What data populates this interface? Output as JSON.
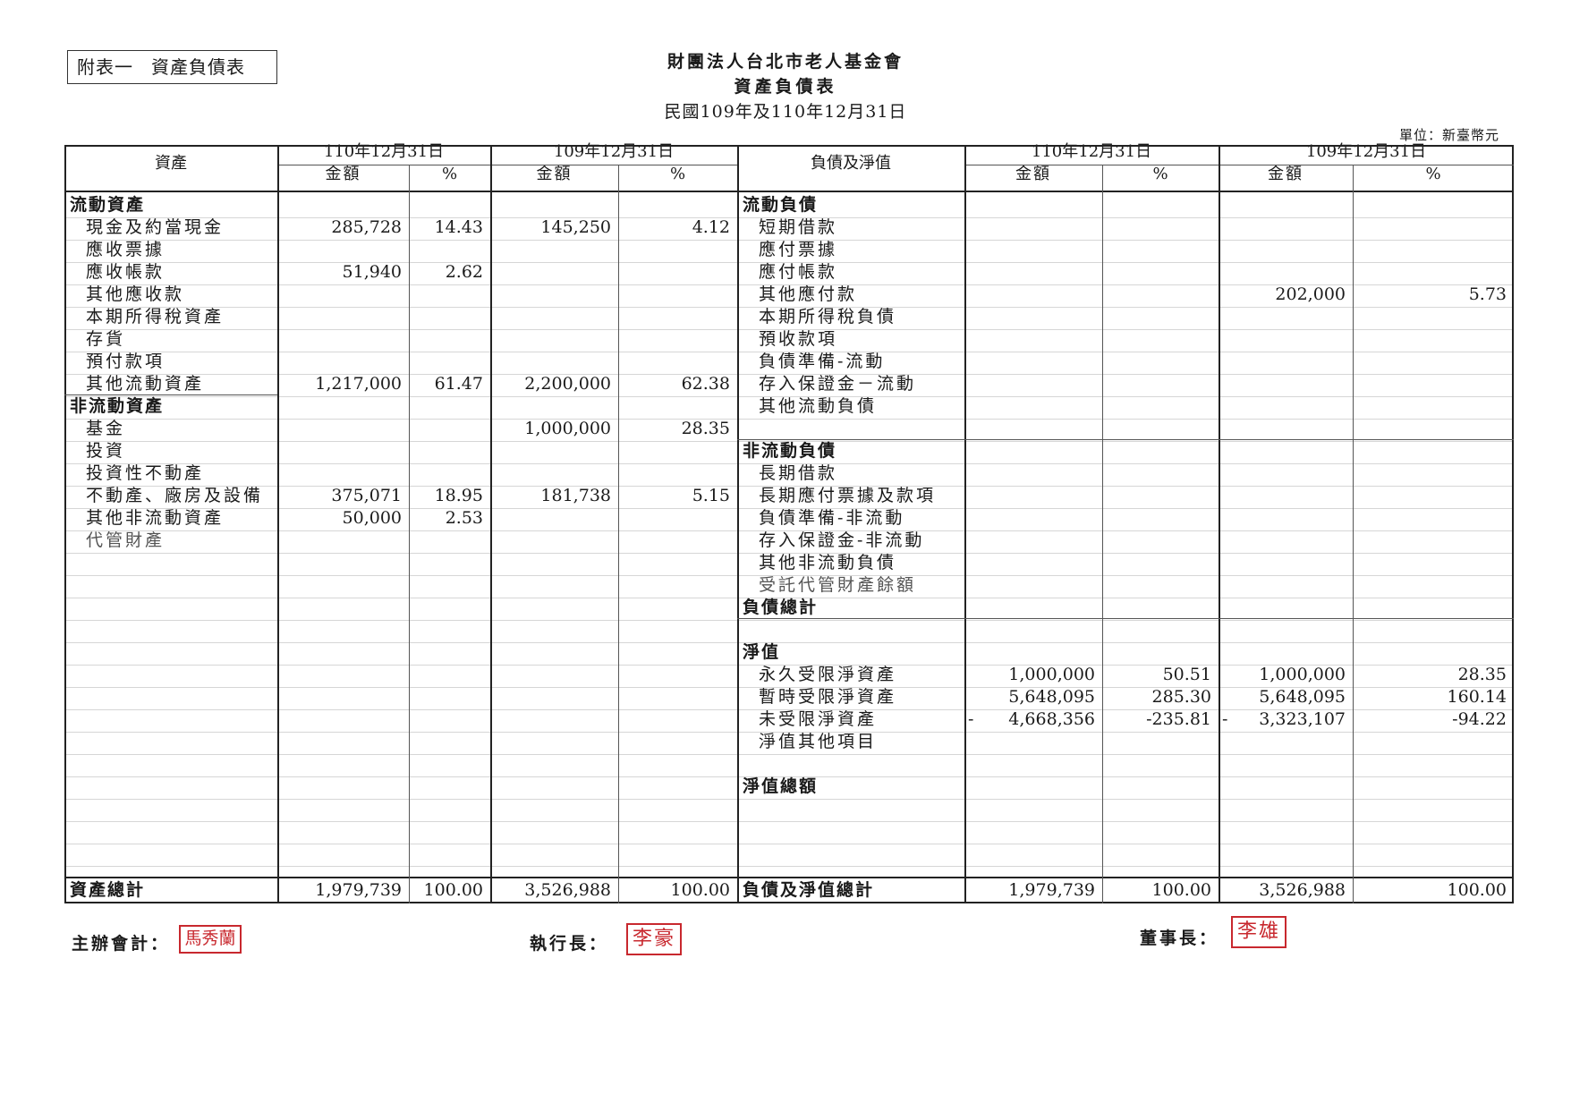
{
  "label": {
    "prefix": "附表一",
    "name": "資產負債表"
  },
  "header": {
    "org": "財團法人台北市老人基金會",
    "title": "資產負債表",
    "date": "民國109年及110年12月31日",
    "unit": "單位：新臺幣元"
  },
  "columns": {
    "assets": "資產",
    "liab": "負債及淨值",
    "cur_year": "110年12月31日",
    "prev_year": "109年12月31日",
    "amount": "金額",
    "pct": "%"
  },
  "assets": [
    {
      "label": "流動資產",
      "kind": "sec"
    },
    {
      "label": "現金及約當現金",
      "a1": "285,728",
      "p1": "14.43",
      "a2": "145,250",
      "p2": "4.12"
    },
    {
      "label": "應收票據"
    },
    {
      "label": "應收帳款",
      "a1": "51,940",
      "p1": "2.62"
    },
    {
      "label": "其他應收款"
    },
    {
      "label": "本期所得稅資產"
    },
    {
      "label": "存貨"
    },
    {
      "label": "預付款項"
    },
    {
      "label": "其他流動資產",
      "a1": "1,217,000",
      "p1": "61.47",
      "a2": "2,200,000",
      "p2": "62.38"
    },
    {
      "label": "非流動資產",
      "kind": "sec"
    },
    {
      "label": "基金",
      "a2": "1,000,000",
      "p2": "28.35"
    },
    {
      "label": "投資"
    },
    {
      "label": "投資性不動產"
    },
    {
      "label": "不動產、廠房及設備",
      "a1": "375,071",
      "p1": "18.95",
      "a2": "181,738",
      "p2": "5.15"
    },
    {
      "label": "其他非流動資產",
      "a1": "50,000",
      "p1": "2.53"
    },
    {
      "label": "代管財產",
      "kind": "faded"
    }
  ],
  "liabilities": [
    {
      "label": "流動負債",
      "kind": "sec"
    },
    {
      "label": "短期借款"
    },
    {
      "label": "應付票據"
    },
    {
      "label": "應付帳款"
    },
    {
      "label": "其他應付款",
      "a2": "202,000",
      "p2": "5.73"
    },
    {
      "label": "本期所得稅負債"
    },
    {
      "label": "預收款項"
    },
    {
      "label": "負債準備-流動"
    },
    {
      "label": "存入保證金－流動"
    },
    {
      "label": "其他流動負債"
    },
    {
      "label": ""
    },
    {
      "label": "非流動負債",
      "kind": "sec"
    },
    {
      "label": "長期借款"
    },
    {
      "label": "長期應付票據及款項"
    },
    {
      "label": "負債準備-非流動"
    },
    {
      "label": "存入保證金-非流動"
    },
    {
      "label": "其他非流動負債"
    },
    {
      "label": "受託代管財產餘額",
      "kind": "faded"
    },
    {
      "label": "負債總計",
      "kind": "sec"
    },
    {
      "label": ""
    },
    {
      "label": "淨值",
      "kind": "sec"
    },
    {
      "label": "永久受限淨資產",
      "a1": "1,000,000",
      "p1": "50.51",
      "a2": "1,000,000",
      "p2": "28.35"
    },
    {
      "label": "暫時受限淨資產",
      "a1": "5,648,095",
      "p1": "285.30",
      "a2": "5,648,095",
      "p2": "160.14"
    },
    {
      "label": "未受限淨資產",
      "a1": "4,668,356",
      "p1": "-235.81",
      "a2": "3,323,107",
      "p2": "-94.22",
      "d1": "-",
      "d2": "-"
    },
    {
      "label": "淨值其他項目"
    },
    {
      "label": ""
    },
    {
      "label": "淨值總額",
      "kind": "sec"
    }
  ],
  "totals": {
    "assets": {
      "label": "資產總計",
      "a1": "1,979,739",
      "p1": "100.00",
      "a2": "3,526,988",
      "p2": "100.00"
    },
    "liab": {
      "label": "負債及淨值總計",
      "a1": "1,979,739",
      "p1": "100.00",
      "a2": "3,526,988",
      "p2": "100.00"
    }
  },
  "signatures": {
    "accountant": {
      "label": "主辦會計：",
      "seal": "馬秀蘭"
    },
    "ceo": {
      "label": "執行長：",
      "seal": "李豪"
    },
    "chair": {
      "label": "董事長：",
      "seal": "李雄"
    }
  }
}
